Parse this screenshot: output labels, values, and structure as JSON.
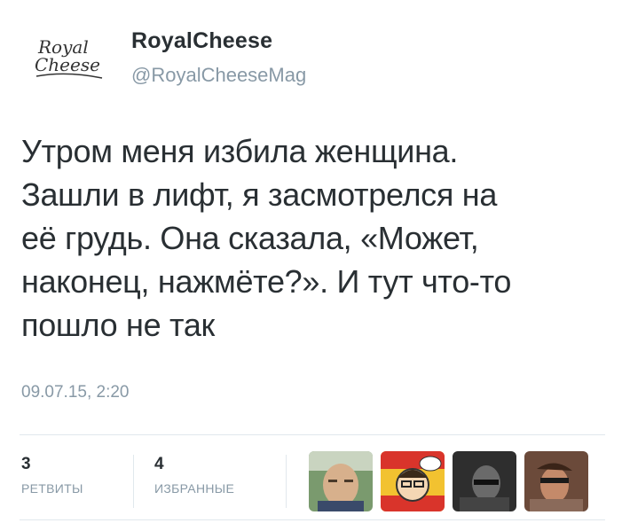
{
  "author": {
    "name": "RoyalCheese",
    "handle": "@RoyalCheeseMag",
    "logo_text_line1": "Royal",
    "logo_text_line2": "Cheese"
  },
  "tweet": {
    "lines": [
      "Утром меня избила женщина.",
      "Зашли в лифт, я засмотрелся на",
      "её грудь. Она сказала, «Может,",
      "наконец, нажмёте?». И тут что-то",
      "пошло не так"
    ],
    "timestamp": "09.07.15, 2:20"
  },
  "stats": {
    "retweets": {
      "count": "3",
      "label": "РЕТВИТЫ"
    },
    "favorites": {
      "count": "4",
      "label": "ИЗБРАННЫЕ"
    }
  },
  "favorited_by": [
    {
      "icon": "user-avatar-1"
    },
    {
      "icon": "user-avatar-2"
    },
    {
      "icon": "user-avatar-3"
    },
    {
      "icon": "user-avatar-4"
    }
  ],
  "colors": {
    "text": "#292f33",
    "secondary": "#8899a6",
    "divider": "#e1e8ed"
  }
}
